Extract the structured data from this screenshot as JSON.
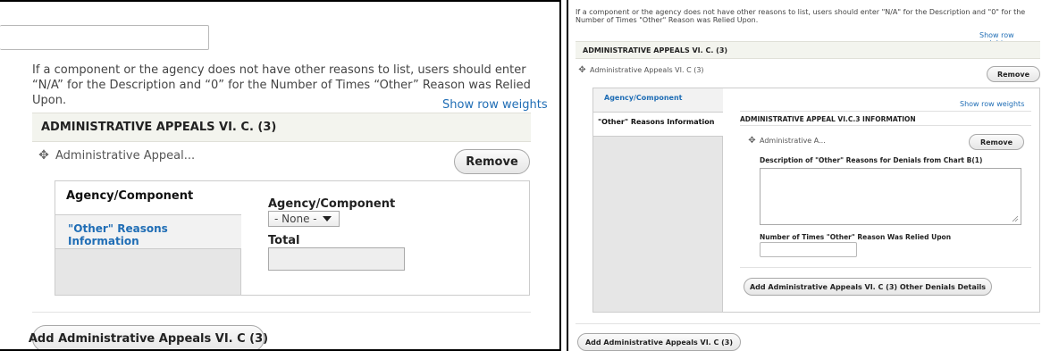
{
  "left_panel": {
    "help_text": "If a component or the agency does not have other reasons to list, users should enter “N/A” for the Description and “0” for the Number of Times “Other” Reason was Relied Upon.",
    "show_row_weights": "Show row weights",
    "section_title": "ADMINISTRATIVE APPEALS VI. C. (3)",
    "item_label": "Administrative Appeal...",
    "remove_label": "Remove",
    "tabs": [
      {
        "label": "Agency/Component"
      },
      {
        "label": "\"Other\" Reasons Information"
      }
    ],
    "agency_component_label": "Agency/Component",
    "agency_component_value": "- None -",
    "total_label": "Total",
    "add_button": "Add Administrative Appeals VI. C (3)"
  },
  "right_panel": {
    "help_text": "If a component or the agency does not have other reasons to list, users should enter \"N/A\" for the Description and \"0\" for the Number of Times \"Other\" Reason was Relied Upon.",
    "show_row_weights": "Show row weights",
    "section_title": "ADMINISTRATIVE APPEALS VI. C. (3)",
    "item_label": "Administrative Appeals VI. C (3)",
    "remove_label": "Remove",
    "tabs": [
      {
        "label": "Agency/Component"
      },
      {
        "label": "\"Other\" Reasons Information"
      }
    ],
    "inner_show_row_weights": "Show row weights",
    "inner_section_title": "ADMINISTRATIVE APPEAL VI.C.3 INFORMATION",
    "inner_item_label": "Administrative A...",
    "inner_remove_label": "Remove",
    "description_label": "Description of \"Other\" Reasons for Denials from Chart B(1)",
    "number_label": "Number of Times \"Other\" Reason Was Relied Upon",
    "add_details_button": "Add Administrative Appeals VI. C (3) Other Denials Details",
    "add_button": "Add Administrative Appeals VI. C (3)"
  },
  "colors": {
    "link": "#1f6db5",
    "section_bg": "#f3f4ee",
    "tab_column_bg": "#e6e6e6"
  },
  "icons": {
    "drag_handle": "move-cross-icon",
    "select_caret": "caret-down-icon",
    "textarea_resize": "resize-grip-icon"
  }
}
